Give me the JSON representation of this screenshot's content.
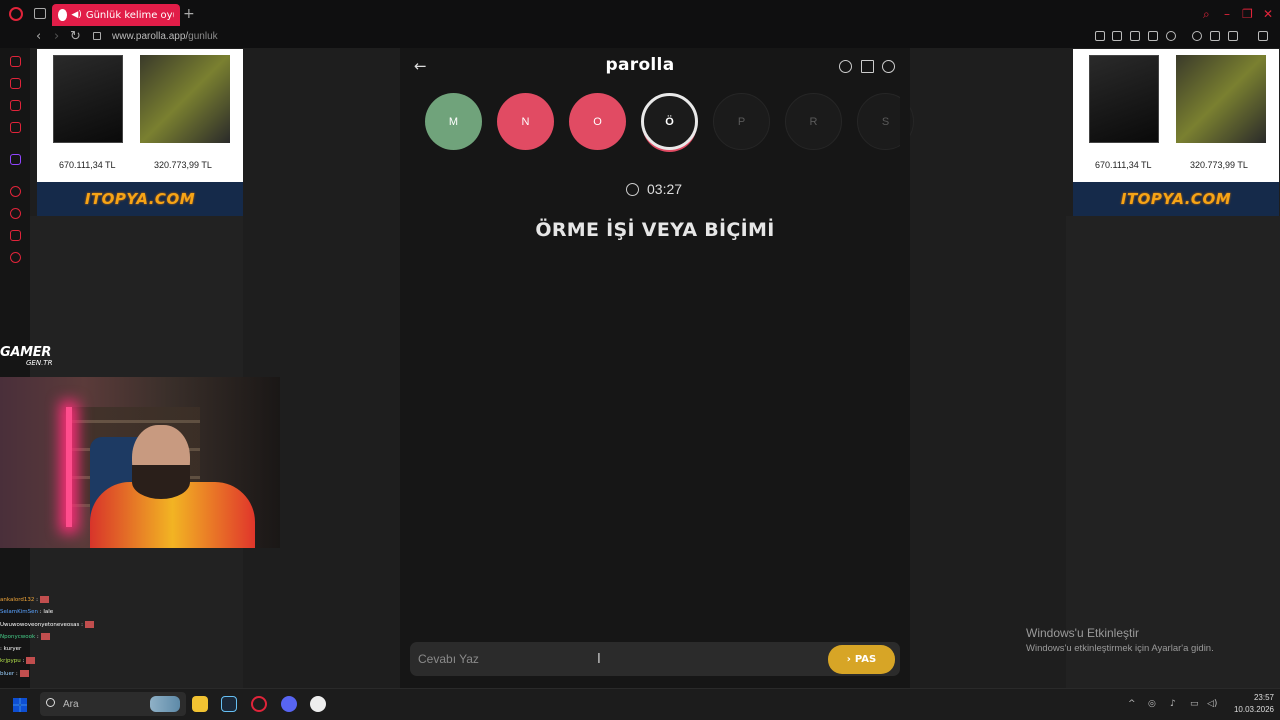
{
  "browser": {
    "tab_title": "Günlük kelime oyunu -",
    "new_tab": "+",
    "url_domain": "www.parolla.app/",
    "url_path": "gunluk"
  },
  "app": {
    "logo": "parolla",
    "back": "←",
    "letters": [
      {
        "letter": "M",
        "state": "correct"
      },
      {
        "letter": "N",
        "state": "wrong"
      },
      {
        "letter": "O",
        "state": "wrong"
      },
      {
        "letter": "Ö",
        "state": "active"
      },
      {
        "letter": "P",
        "state": "pending"
      },
      {
        "letter": "R",
        "state": "pending"
      },
      {
        "letter": "S",
        "state": "pending"
      }
    ],
    "timer": "03:27",
    "question": "ÖRME İŞİ VEYA BİÇİMİ",
    "answer_placeholder": "Cevabı Yaz",
    "pass_label": "PAS",
    "pass_arrow": "›"
  },
  "ads": {
    "price1": "670.111,34 TL",
    "price2": "320.773,99 TL",
    "brand": "ITOPYA.COM"
  },
  "overlay": {
    "gamer_main": "GAMER",
    "gamer_sub": "GEN.TR"
  },
  "chat": [
    {
      "user": "ankalord132",
      "color": "#f0a63a",
      "msg": ""
    },
    {
      "user": "SelamKimSen",
      "color": "#5aa3ff",
      "msg": "lale"
    },
    {
      "user": "Uwuwowoveonyetoneveosas",
      "color": "#ffffff",
      "msg": ""
    },
    {
      "user": "Nponycwook",
      "color": "#46d08a",
      "msg": ""
    },
    {
      "user": "",
      "color": "#e94b4b",
      "msg": "kuryer"
    },
    {
      "user": "krjpypu",
      "color": "#b2e04a",
      "msg": ""
    },
    {
      "user": "bluer",
      "color": "#9ad1ff",
      "msg": ""
    }
  ],
  "watermark": {
    "title": "Windows'u Etkinleştir",
    "subtitle": "Windows'u etkinleştirmek için Ayarlar'a gidin."
  },
  "taskbar": {
    "search_text": "Ara",
    "time": "23:57",
    "date": "10.03.2026"
  },
  "colors": {
    "correct": "#70a37b",
    "wrong": "#e14b63",
    "pass": "#d7a526",
    "accent": "#e11d48"
  }
}
